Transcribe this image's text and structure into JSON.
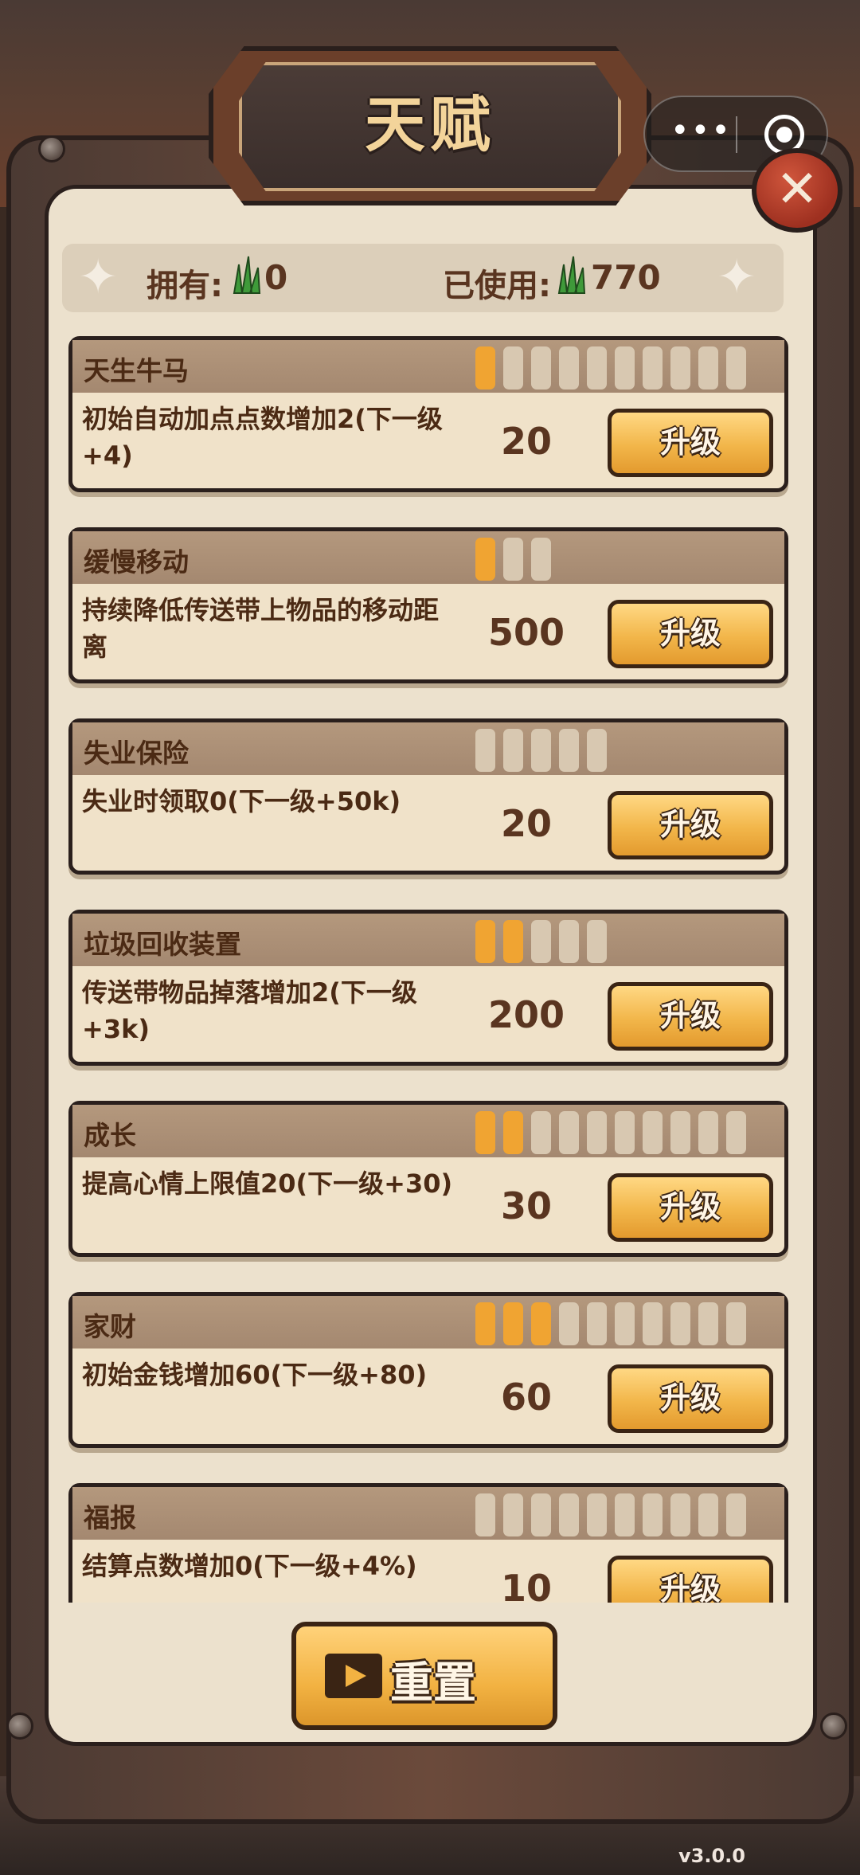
{
  "header": {
    "title": "天赋"
  },
  "stats": {
    "owned_label": "拥有:",
    "owned_value": "0",
    "used_label": "已使用:",
    "used_value": "770"
  },
  "talents": [
    {
      "name": "天生牛马",
      "desc": "初始自动加点点数增加2(下一级+4)",
      "cost": "20",
      "level": 1,
      "max": 10
    },
    {
      "name": "缓慢移动",
      "desc": "持续降低传送带上物品的移动距离",
      "cost": "500",
      "level": 1,
      "max": 3
    },
    {
      "name": "失业保险",
      "desc": "失业时领取0(下一级+50k)",
      "cost": "20",
      "level": 0,
      "max": 5
    },
    {
      "name": "垃圾回收装置",
      "desc": "传送带物品掉落增加2(下一级+3k)",
      "cost": "200",
      "level": 2,
      "max": 5
    },
    {
      "name": "成长",
      "desc": "提高心情上限值20(下一级+30)",
      "cost": "30",
      "level": 2,
      "max": 10
    },
    {
      "name": "家财",
      "desc": "初始金钱增加60(下一级+80)",
      "cost": "60",
      "level": 3,
      "max": 10
    },
    {
      "name": "福报",
      "desc": "结算点数增加0(下一级+4%)",
      "cost": "10",
      "level": 0,
      "max": 10
    }
  ],
  "upgrade_label": "升级",
  "reset_label": "重置",
  "version": "v3.0.0",
  "colors": {
    "pip_on": "#f0a432",
    "pip_off": "#d8c8b1",
    "button": "#f2b64a",
    "close": "#c0452f"
  }
}
